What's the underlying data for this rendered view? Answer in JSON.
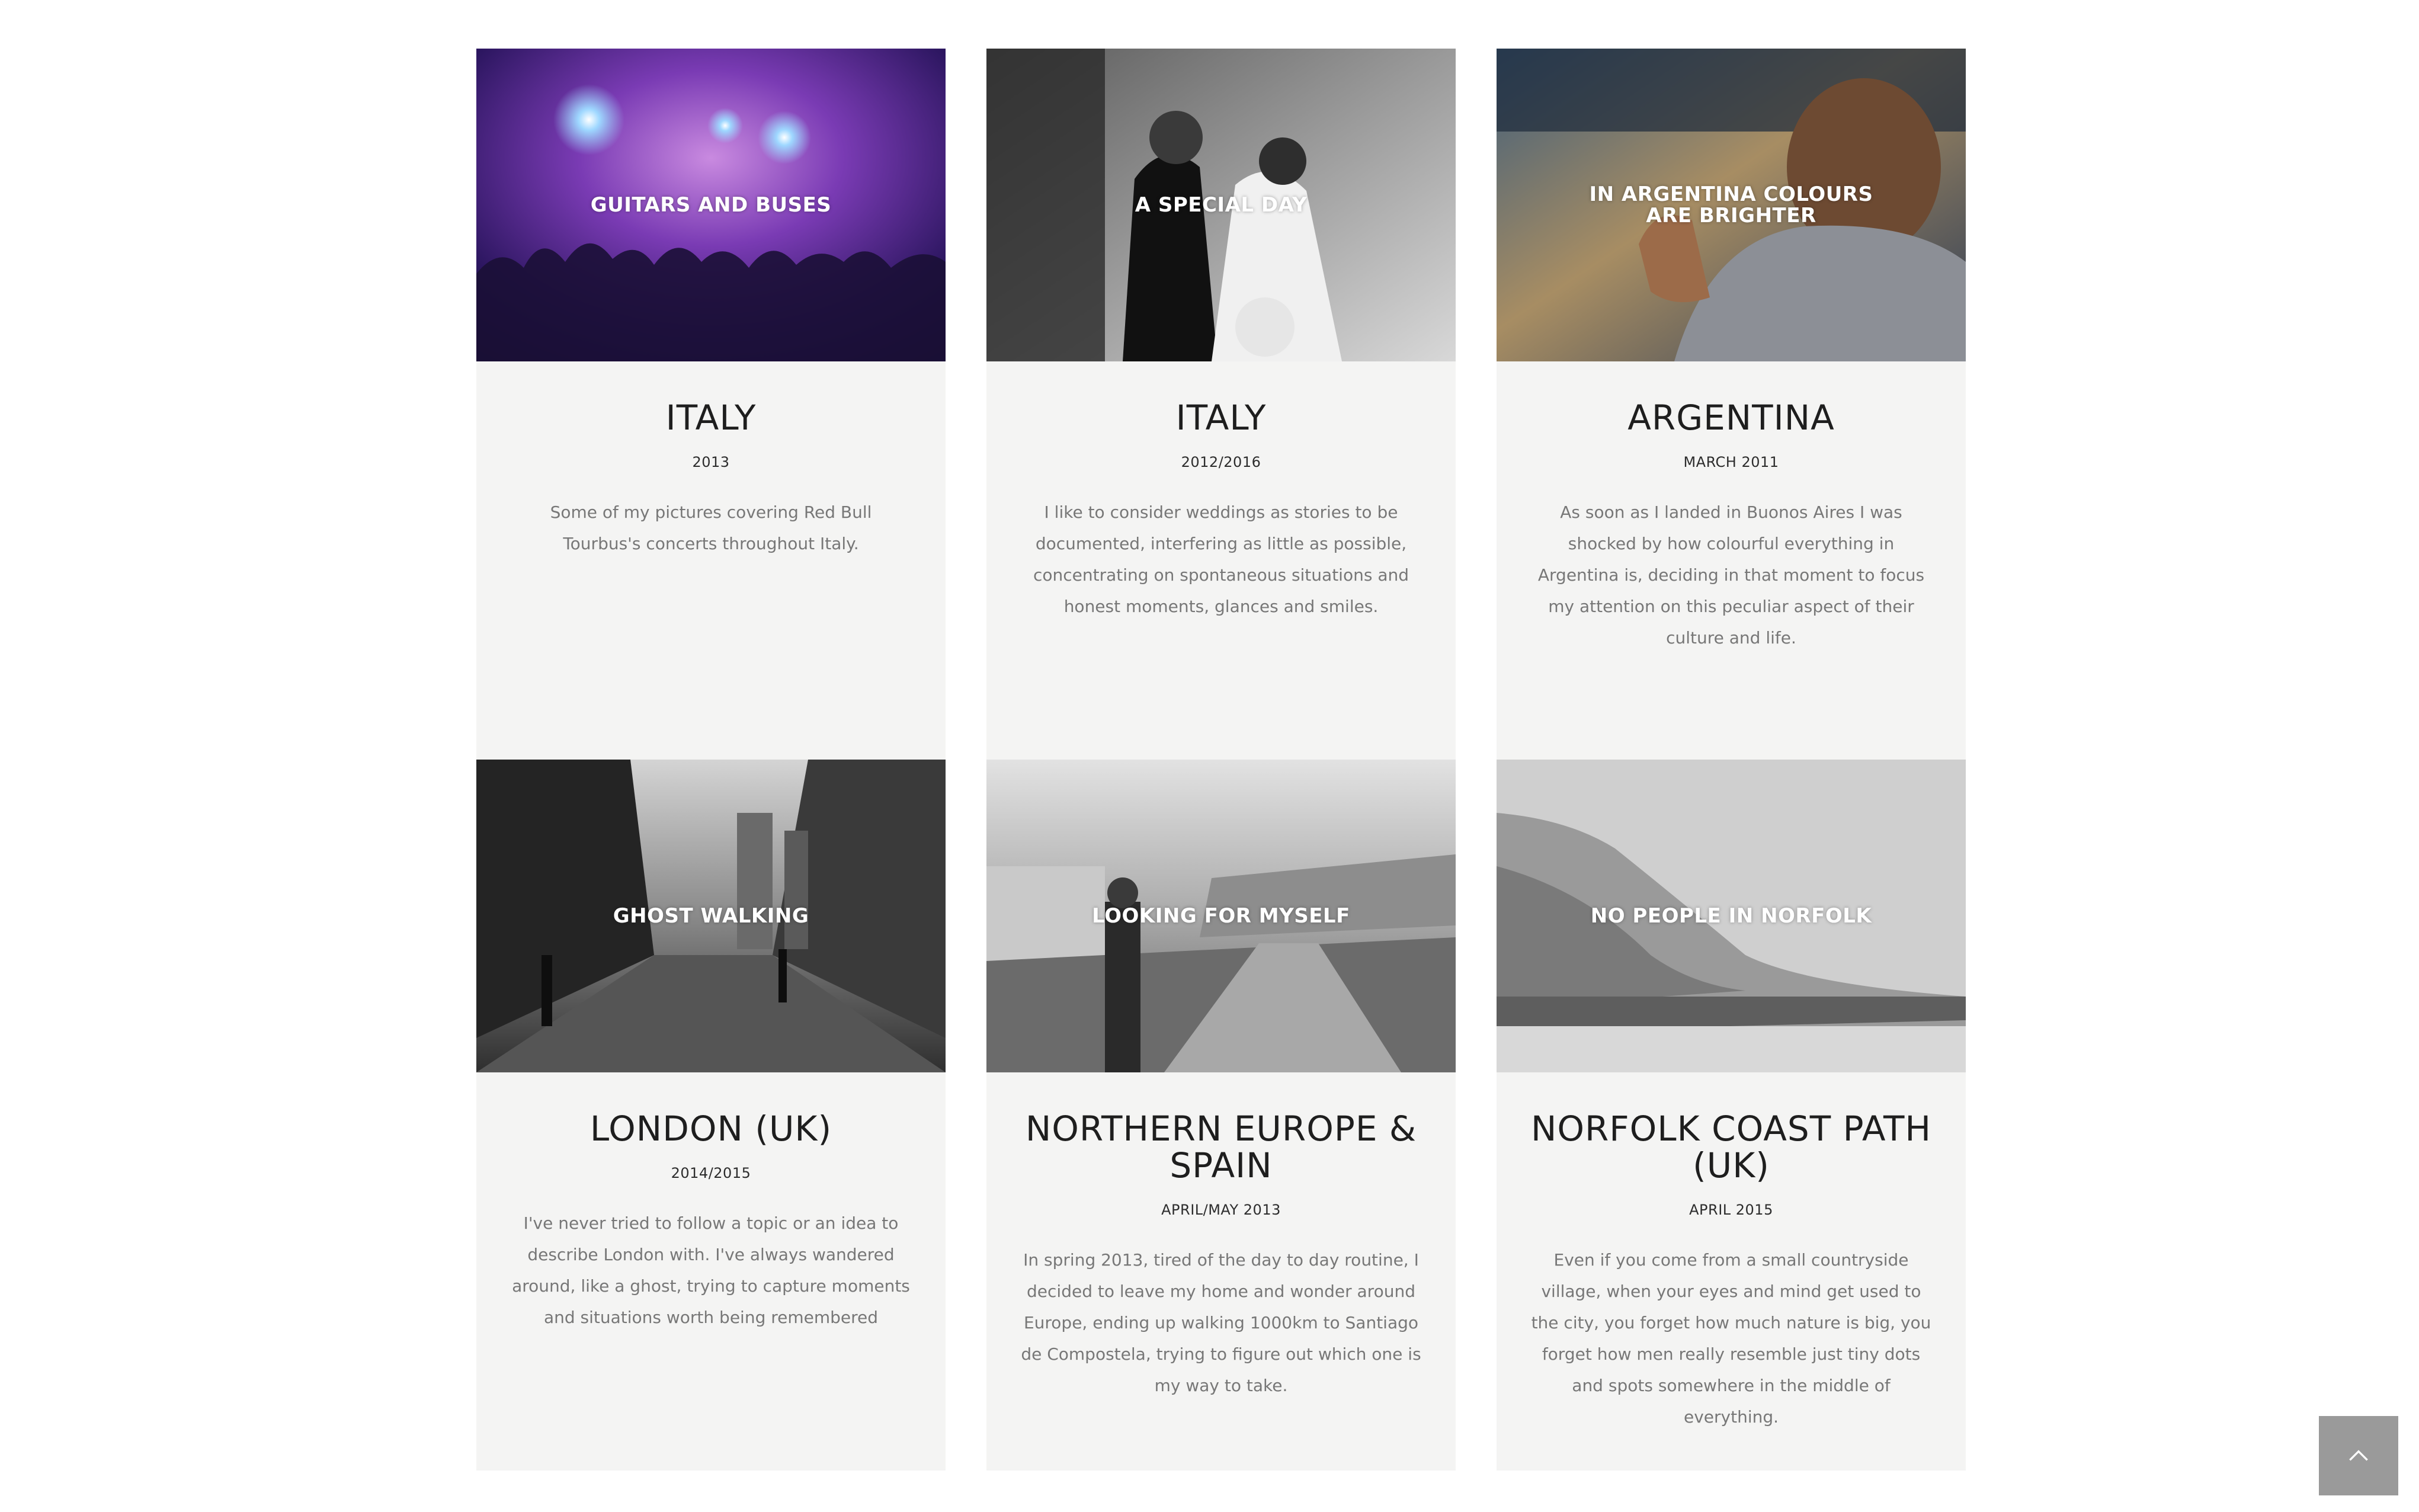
{
  "colors": {
    "card_background": "#f4f4f3",
    "page_background": "#ffffff",
    "title_text": "#1e1e1e",
    "description_text": "#777777",
    "back_to_top_button": "#9a9a9a"
  },
  "projects": [
    {
      "image_caption": "GUITARS AND BUSES",
      "image_subject": "concert crowd under purple stage lights",
      "title": "ITALY",
      "date": "2013",
      "description": "Some of my pictures covering Red Bull Tourbus's concerts throughout Italy."
    },
    {
      "image_caption": "A SPECIAL DAY",
      "image_subject": "black and white wedding couple",
      "title": "ITALY",
      "date": "2012/2016",
      "description": "I like to consider weddings as stories to be documented, interfering as little as possible, concentrating on spontaneous situations and honest moments, glances and smiles."
    },
    {
      "image_caption": "IN ARGENTINA COLOURS\nARE BRIGHTER",
      "image_subject": "elderly man in a car window",
      "title": "ARGENTINA",
      "date": "MARCH 2011",
      "description": "As soon as I landed in Buonos Aires I was shocked by how colourful everything in Argentina is, deciding in that moment to focus my attention on this peculiar aspect of their culture and life."
    },
    {
      "image_caption": "GHOST WALKING",
      "image_subject": "black and white London street with Tower Bridge",
      "title": "LONDON (UK)",
      "date": "2014/2015",
      "description": "I've never tried to follow a topic or an idea to describe London with. I've always wandered around, like a ghost, trying to capture moments and situations worth being remembered"
    },
    {
      "image_caption": "LOOKING FOR MYSELF",
      "image_subject": "black and white hiker on a road near a village",
      "title": "NORTHERN EUROPE & SPAIN",
      "date": "APRIL/MAY 2013",
      "description": "In spring 2013, tired of the day to day routine, I decided to leave my home and wonder around Europe, ending up walking 1000km to Santiago de Compostela, trying to figure out which one is my way to take."
    },
    {
      "image_caption": "NO PEOPLE IN NORFOLK",
      "image_subject": "grey coastal cliffs and beach",
      "title": "NORFOLK COAST PATH (UK)",
      "date": "APRIL 2015",
      "description": "Even if you come from a small countryside village, when your eyes and mind get used to the city, you forget how much nature is big, you forget how men really resemble just tiny dots and spots somewhere in the middle of everything."
    }
  ],
  "back_to_top": {
    "icon": "chevron-up-icon"
  }
}
